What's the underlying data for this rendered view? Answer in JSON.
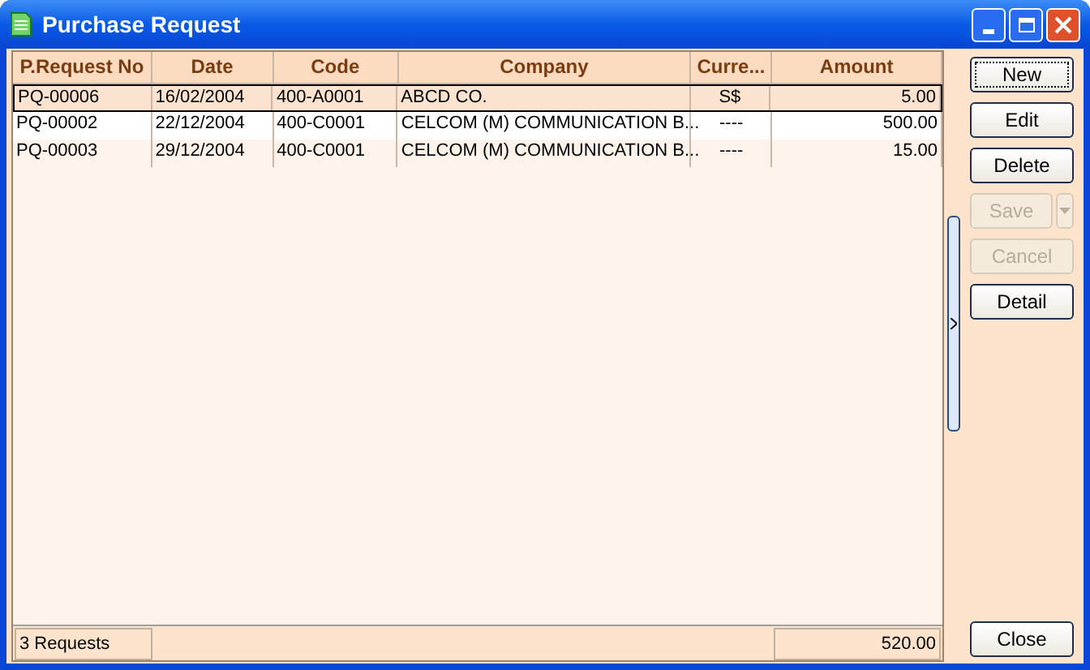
{
  "window": {
    "title": "Purchase Request"
  },
  "table": {
    "columns": [
      "P.Request No",
      "Date",
      "Code",
      "Company",
      "Curre...",
      "Amount"
    ],
    "rows": [
      {
        "selected": true,
        "cells": [
          "PQ-00006",
          "16/02/2004",
          "400-A0001",
          "ABCD CO.",
          "S$",
          "5.00"
        ]
      },
      {
        "selected": false,
        "cells": [
          "PQ-00002",
          "22/12/2004",
          "400-C0001",
          "CELCOM (M) COMMUNICATION B...",
          "----",
          "500.00"
        ]
      },
      {
        "selected": false,
        "cells": [
          "PQ-00003",
          "29/12/2004",
          "400-C0001",
          "CELCOM (M) COMMUNICATION B...",
          "----",
          "15.00"
        ]
      }
    ]
  },
  "status_bar": {
    "count": "3 Requests",
    "total": "520.00"
  },
  "buttons": [
    {
      "label": "New",
      "disabled": false,
      "kind": "plain",
      "default": true
    },
    {
      "label": "Edit",
      "disabled": false,
      "kind": "plain",
      "default": false
    },
    {
      "label": "Delete",
      "disabled": false,
      "kind": "plain",
      "default": false
    },
    {
      "label": "Save",
      "disabled": true,
      "kind": "split",
      "default": false
    },
    {
      "label": "Cancel",
      "disabled": true,
      "kind": "plain",
      "default": false
    },
    {
      "label": "Detail",
      "disabled": false,
      "kind": "plain",
      "default": false
    }
  ],
  "close_button": {
    "label": "Close"
  }
}
